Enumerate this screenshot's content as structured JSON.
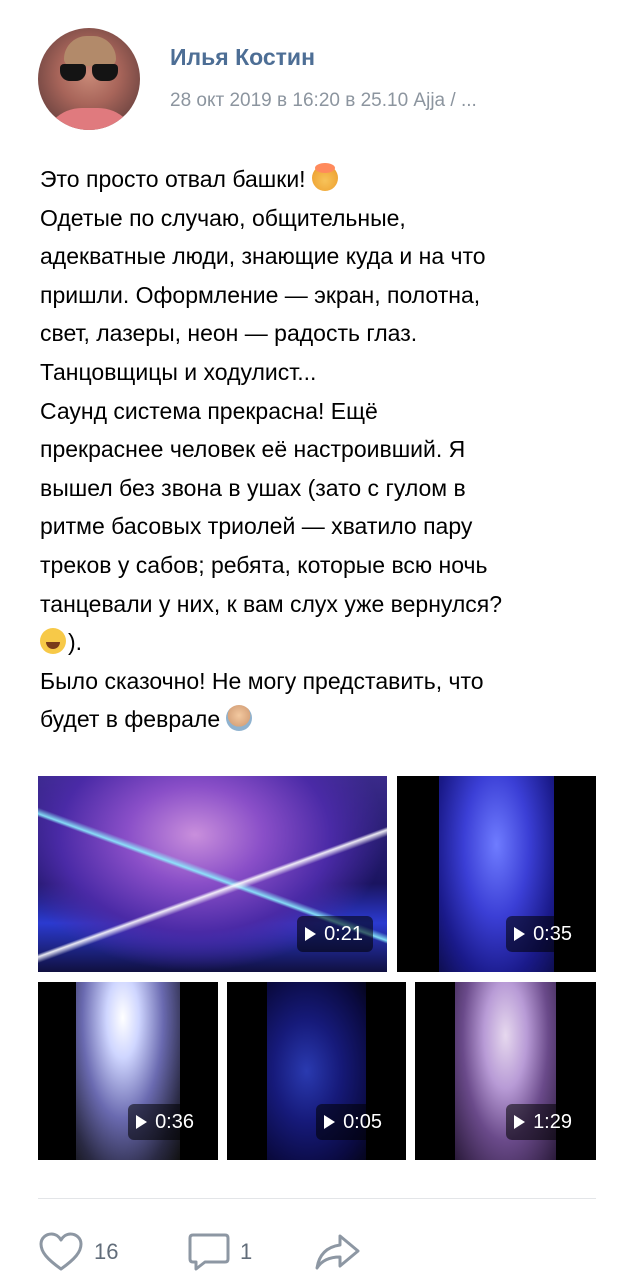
{
  "post": {
    "author": "Илья Костин",
    "meta": "28 окт 2019 в 16:20 в 25.10 Ajja / ...",
    "text_lines": [
      "Это просто отвал башки!",
      "Одетые по случаю, общительные,",
      "адекватные люди, знающие куда и на что",
      "пришли. Оформление — экран, полотна,",
      "свет, лазеры, неон — радость глаз.",
      "Танцовщицы и ходулист...",
      "Саунд система прекрасна! Ещё",
      "прекраснее человек её настроивший. Я",
      "вышел без звона в ушах (зато с гулом в",
      "ритме басовых триолей — хватило пару",
      "треков у сабов; ребята, которые всю ночь",
      "танцевали у них, к вам слух уже вернулся?",
      ").",
      "Было сказочно! Не могу представить, что",
      "будет в феврале"
    ],
    "emojis": [
      "exploding-head",
      "grinning-squinting-face",
      "person-emoji"
    ],
    "videos": [
      {
        "duration": "0:21"
      },
      {
        "duration": "0:35"
      },
      {
        "duration": "0:36"
      },
      {
        "duration": "0:05"
      },
      {
        "duration": "1:29"
      }
    ],
    "actions": {
      "likes": "16",
      "comments": "1",
      "icons": [
        "heart-icon",
        "comment-icon",
        "share-icon"
      ]
    }
  },
  "colors": {
    "author": "#4d6e95",
    "meta": "#8c959f",
    "action": "#626d7a"
  }
}
